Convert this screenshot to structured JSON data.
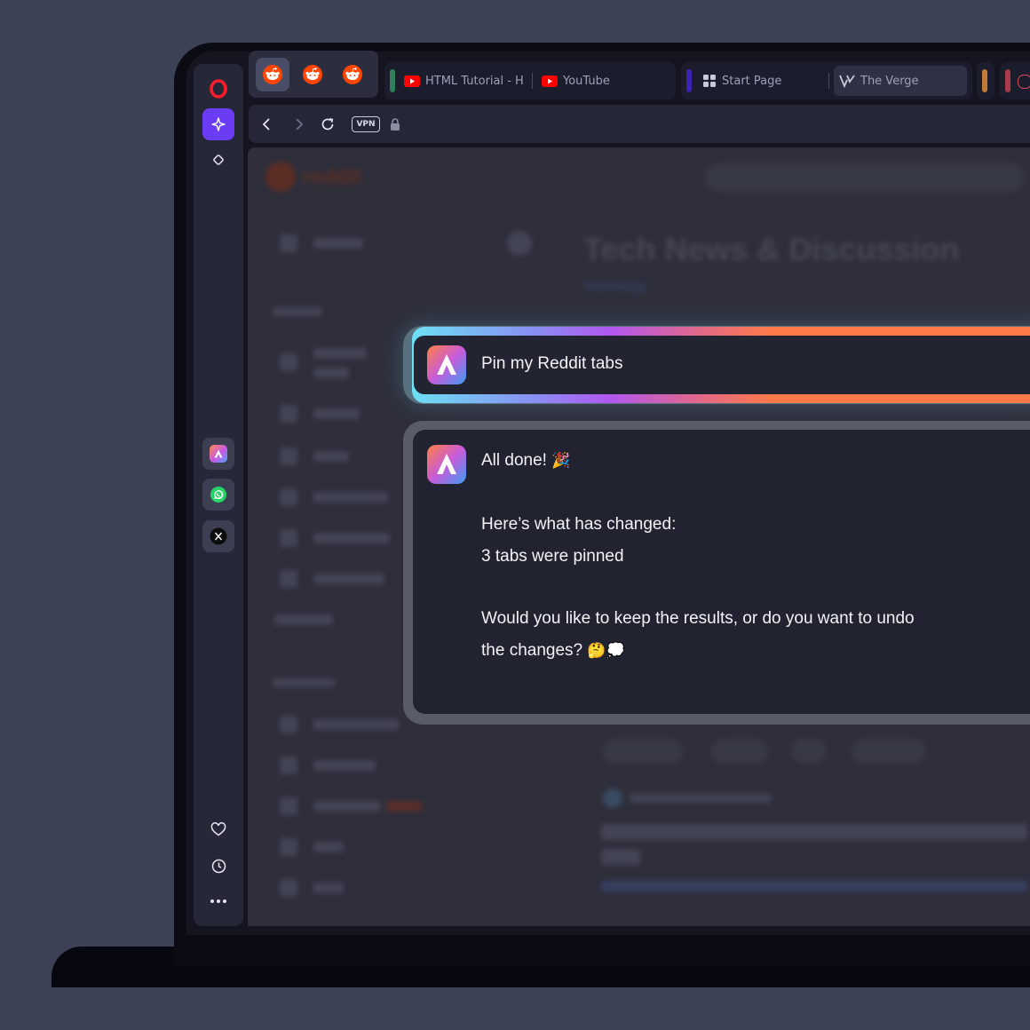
{
  "tabs": {
    "pinned": [
      "reddit",
      "reddit",
      "reddit"
    ],
    "group1": [
      {
        "title": "HTML Tutorial - H",
        "icon": "youtube-icon"
      },
      {
        "title": "YouTube",
        "icon": "youtube-icon"
      }
    ],
    "group2": [
      {
        "title": "Start Page",
        "icon": "grid-icon"
      },
      {
        "title": "The Verge",
        "icon": "verge-icon"
      }
    ]
  },
  "addressbar": {
    "vpn_label": "VPN"
  },
  "page": {
    "site_name": "reddit",
    "title": "Tech News & Discussion",
    "subtitle": "Technology"
  },
  "aria": {
    "prompt": "Pin my Reddit tabs",
    "response": {
      "line1": "All done!",
      "line1_emoji": "🎉",
      "line2": "Here’s what has changed:",
      "line3": "3 tabs were pinned",
      "line4": "Would you like to keep the results, or do you want to undo",
      "line5": "the changes?",
      "line5_emoji": "🤔💭"
    }
  },
  "colors": {
    "background": "#3d4156",
    "sidebar": "#262838",
    "accent_purple": "#6a3cf6",
    "opera_red": "#ff1b2d",
    "reddit_orange": "#ff4500"
  }
}
